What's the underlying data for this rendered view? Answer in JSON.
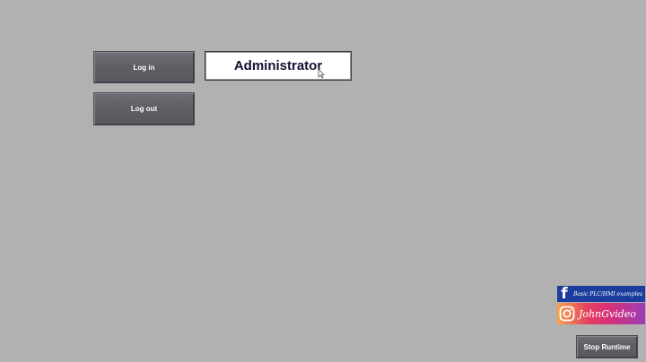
{
  "buttons": {
    "login_label": "Log in",
    "logout_label": "Log out",
    "stop_runtime_label": "Stop Runtime"
  },
  "user_display": {
    "value": "Administrator"
  },
  "social": {
    "facebook_text": "Basic PLC/HMI examples",
    "instagram_text": "JohnGvideo",
    "facebook_icon": "facebook-icon",
    "instagram_icon": "instagram-icon"
  },
  "colors": {
    "background": "#b1b1b1",
    "button": "#5f5f65",
    "facebook": "#1c3d9e",
    "instagram_accent": "#e4405f"
  }
}
